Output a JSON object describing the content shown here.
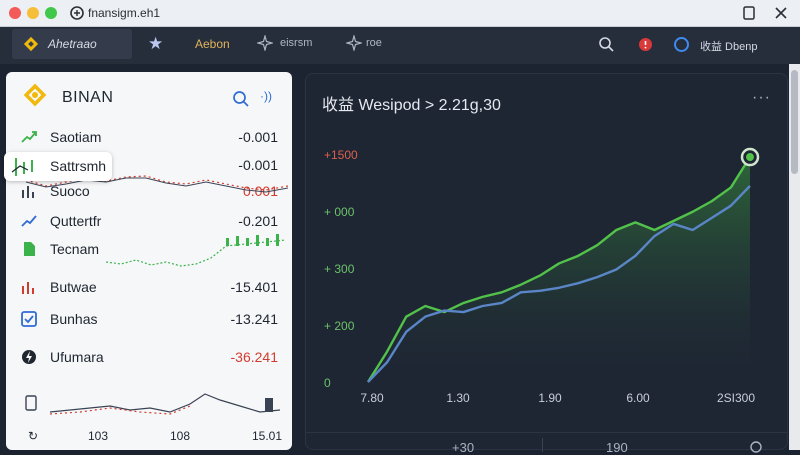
{
  "window": {
    "title": "fnansigm.eh1"
  },
  "navbar": {
    "brand_label": "Ahetraao",
    "item_1": "Aebon",
    "item_2": "eisrsm",
    "item_3": "roe",
    "user_label": "收益 Dbenp"
  },
  "sidebar": {
    "brand": "BINAN",
    "more_label": "·))",
    "items": [
      {
        "name": "Saotiam",
        "value": "-0.001"
      },
      {
        "name": "Sattrsmh",
        "value": "-0.001"
      },
      {
        "name": "Suoco",
        "value": "0.001"
      },
      {
        "name": "Quttertfr",
        "value": "-0.201"
      },
      {
        "name": "Tecnam",
        "value": ""
      },
      {
        "name": "Butwae",
        "value": "-15.401"
      },
      {
        "name": "Bunhas",
        "value": "-13.241"
      },
      {
        "name": "Ufumara",
        "value": "-36.241"
      }
    ],
    "bottom_labels": [
      "103",
      "108",
      "15.01"
    ]
  },
  "chart": {
    "title": "收益 Wesipod > 2.21g,30",
    "more": "···",
    "footer": [
      "+30",
      "190"
    ]
  },
  "colors": {
    "accent_green": "#4fbf4a",
    "series_blue": "#5a86c8",
    "negative_red": "#d23c2f",
    "brand_yellow": "#f0b90b"
  },
  "chart_data": {
    "type": "line",
    "title": "收益 Wesipod > 2.21g,30",
    "x_tick_labels": [
      "7.80",
      "1.30",
      "1.90",
      "6.00",
      "2SI300"
    ],
    "y_tick_labels": [
      "0",
      "+ 200",
      "+ 300",
      "+ 000",
      "+1500"
    ],
    "ylim": [
      0,
      1500
    ],
    "grid": false,
    "series": [
      {
        "color": "#52c24a",
        "values": [
          0,
          200,
          430,
          500,
          460,
          520,
          560,
          590,
          640,
          700,
          780,
          830,
          900,
          1000,
          1050,
          1000,
          1060,
          1120,
          1190,
          1280,
          1480
        ]
      },
      {
        "color": "#5a86c8",
        "values": [
          0,
          130,
          330,
          430,
          470,
          460,
          500,
          520,
          590,
          600,
          620,
          650,
          690,
          740,
          830,
          960,
          1040,
          1000,
          1080,
          1160,
          1290
        ]
      }
    ]
  }
}
